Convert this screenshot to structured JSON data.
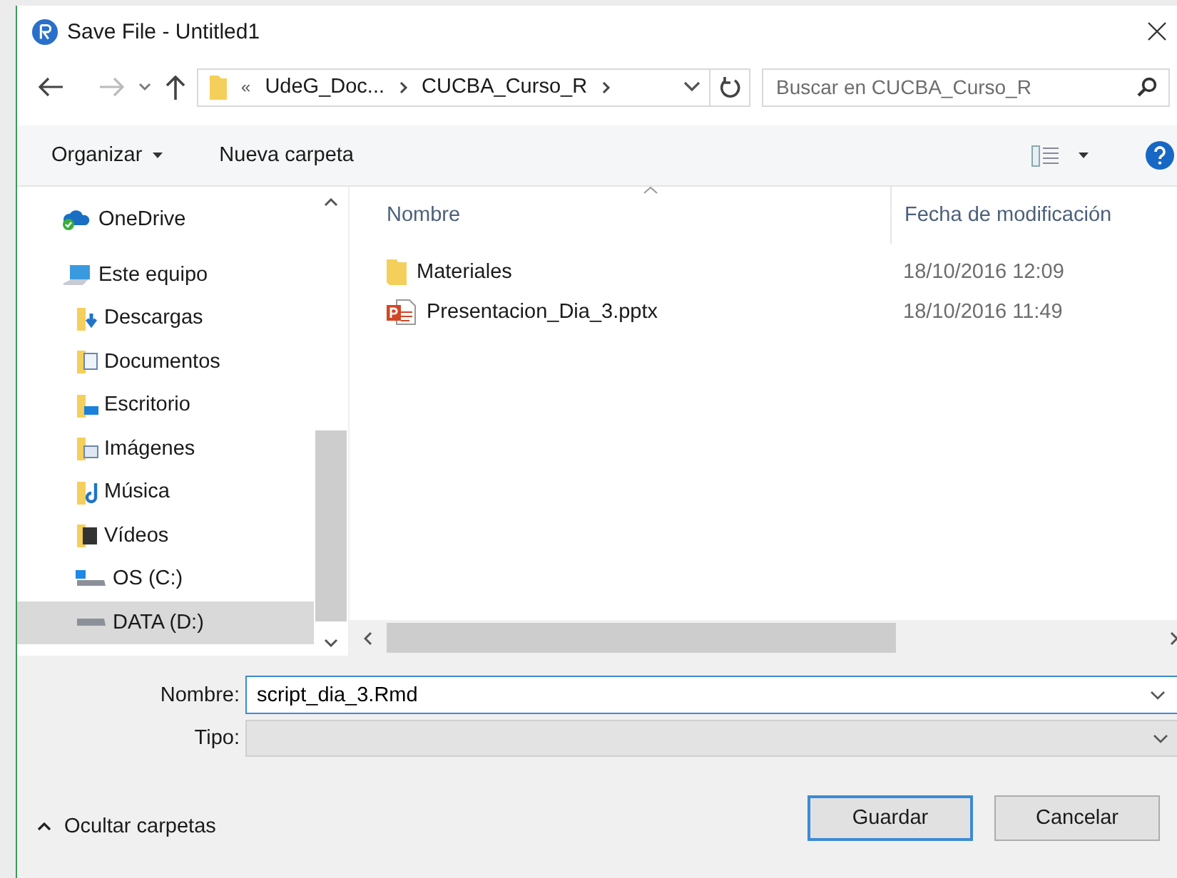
{
  "window": {
    "title": "Save File - Untitled1"
  },
  "address_bar": {
    "overflow": "«",
    "segments": [
      "UdeG_Doc...",
      "CUCBA_Curso_R"
    ]
  },
  "search": {
    "placeholder": "Buscar en CUCBA_Curso_R"
  },
  "toolbar": {
    "organize": "Organizar",
    "new_folder": "Nueva carpeta"
  },
  "sidebar": {
    "items": [
      {
        "label": "OneDrive",
        "kind": "onedrive",
        "selected": false
      },
      {
        "label": "Este equipo",
        "kind": "pc",
        "selected": false,
        "children": [
          {
            "label": "Descargas",
            "kind": "downloads",
            "selected": false
          },
          {
            "label": "Documentos",
            "kind": "documents",
            "selected": false
          },
          {
            "label": "Escritorio",
            "kind": "desktop",
            "selected": false
          },
          {
            "label": "Imágenes",
            "kind": "pictures",
            "selected": false
          },
          {
            "label": "Música",
            "kind": "music",
            "selected": false
          },
          {
            "label": "Vídeos",
            "kind": "videos",
            "selected": false
          },
          {
            "label": "OS (C:)",
            "kind": "os-drive",
            "selected": false
          },
          {
            "label": "DATA (D:)",
            "kind": "drive",
            "selected": true
          }
        ]
      }
    ]
  },
  "files": {
    "columns": [
      "Nombre",
      "Fecha de modificación"
    ],
    "rows": [
      {
        "name": "Materiales",
        "kind": "folder",
        "date": "18/10/2016 12:09"
      },
      {
        "name": "Presentacion_Dia_3.pptx",
        "kind": "pptx",
        "date": "18/10/2016 11:49"
      }
    ]
  },
  "form": {
    "name_label": "Nombre:",
    "name_value": "script_dia_3.Rmd",
    "type_label": "Tipo:"
  },
  "hide_folders": "Ocultar carpetas",
  "buttons": [
    {
      "label": "Guardar",
      "default": true
    },
    {
      "label": "Cancelar",
      "default": false
    }
  ]
}
